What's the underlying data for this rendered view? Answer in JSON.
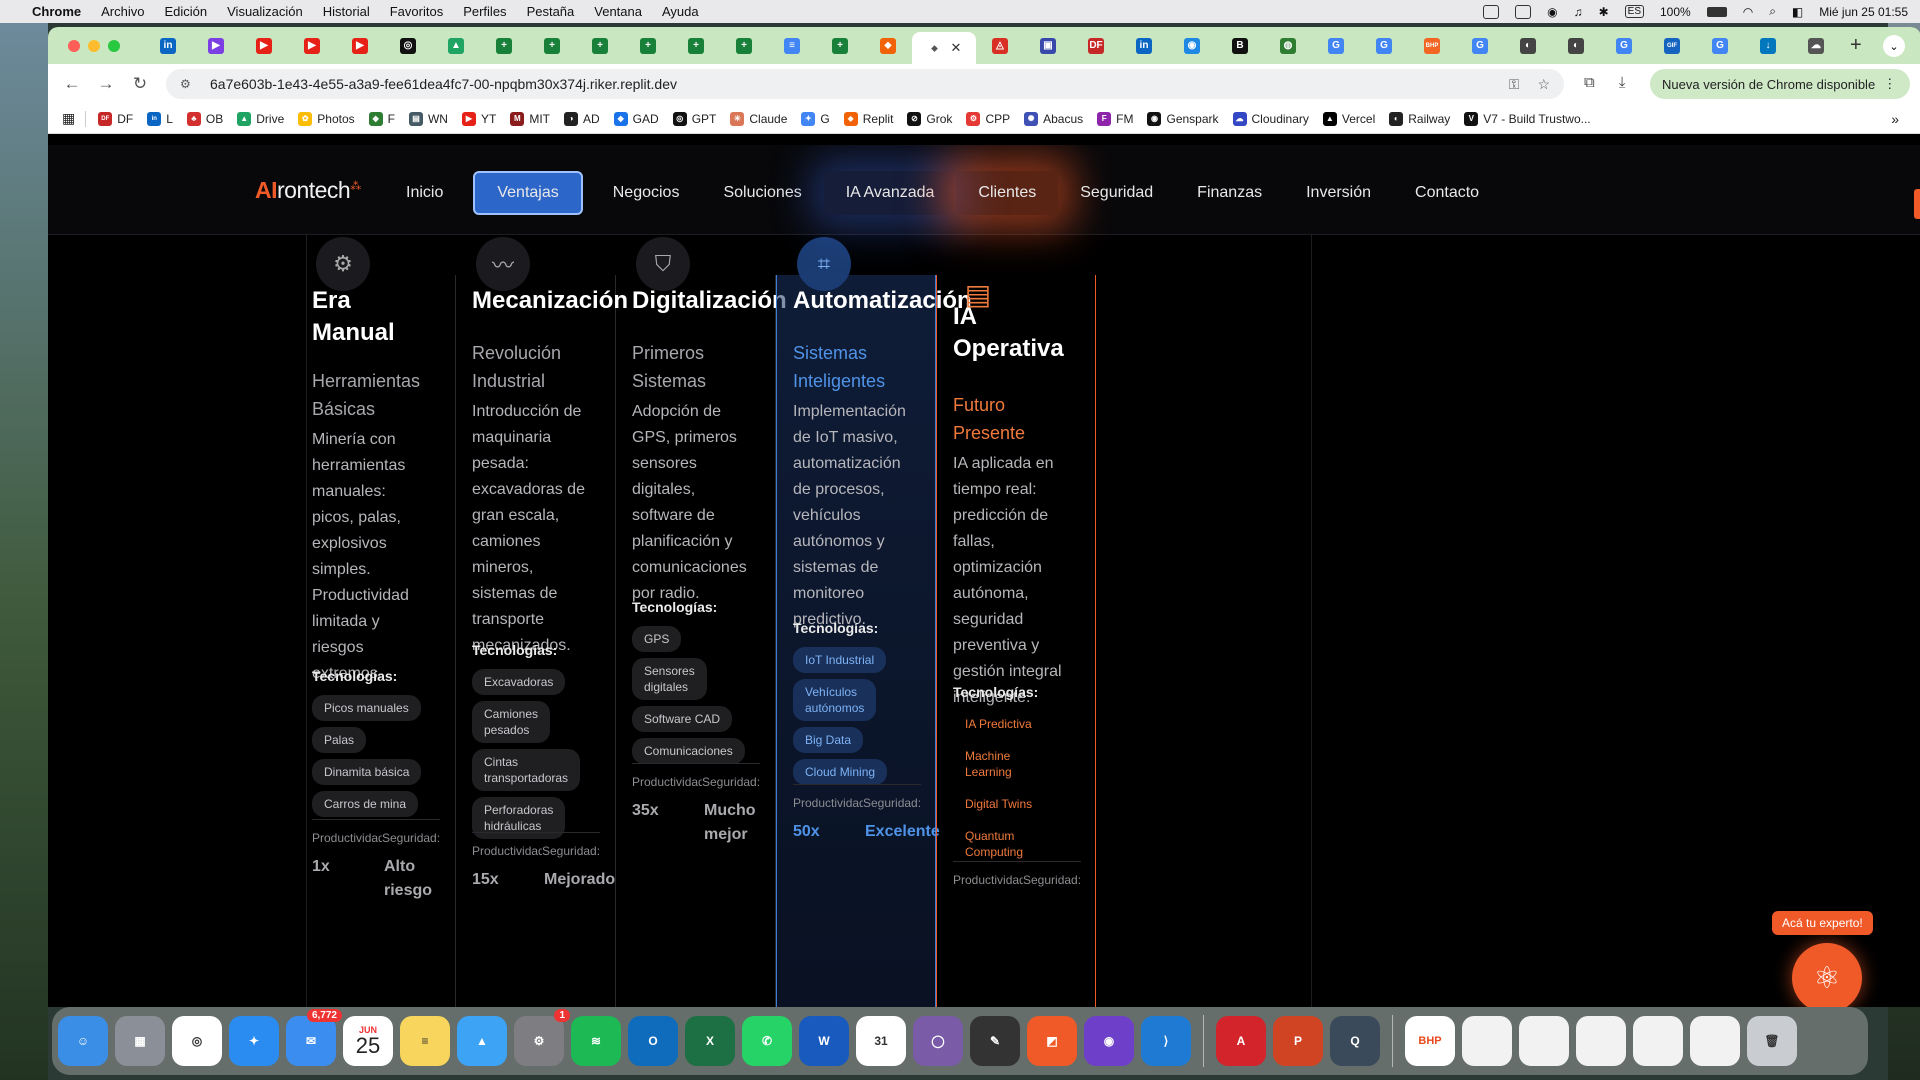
{
  "menubar": {
    "app": "Chrome",
    "items": [
      "Archivo",
      "Edición",
      "Visualización",
      "Historial",
      "Favoritos",
      "Perfiles",
      "Pestaña",
      "Ventana",
      "Ayuda"
    ],
    "battery": "100%",
    "input_source": "ES",
    "datetime": "Mié jun 25  01:55"
  },
  "browser": {
    "url": "6a7e603b-1e43-4e55-a3a9-fee61dea4fc7-00-npqbm30x374j.riker.replit.dev",
    "update_label": "Nueva versión de Chrome disponible",
    "tab_favicons": [
      {
        "glyph": "in",
        "color": "#0a66c2"
      },
      {
        "glyph": "▶",
        "color": "#7b3fe4"
      },
      {
        "glyph": "▶",
        "color": "#e62117"
      },
      {
        "glyph": "▶",
        "color": "#e62117"
      },
      {
        "glyph": "▶",
        "color": "#e62117"
      },
      {
        "glyph": "◎",
        "color": "#111111"
      },
      {
        "glyph": "▲",
        "color": "#1fa463"
      },
      {
        "glyph": "+",
        "color": "#188038"
      },
      {
        "glyph": "+",
        "color": "#188038"
      },
      {
        "glyph": "+",
        "color": "#188038"
      },
      {
        "glyph": "+",
        "color": "#188038"
      },
      {
        "glyph": "+",
        "color": "#188038"
      },
      {
        "glyph": "+",
        "color": "#188038"
      },
      {
        "glyph": "≡",
        "color": "#4285f4"
      },
      {
        "glyph": "+",
        "color": "#188038"
      },
      {
        "glyph": "⬥",
        "color": "#f26207"
      }
    ],
    "tab_favicons_right": [
      {
        "glyph": "◬",
        "color": "#d93025"
      },
      {
        "glyph": "▣",
        "color": "#3949ab"
      },
      {
        "glyph": "DF",
        "color": "#c62828"
      },
      {
        "glyph": "in",
        "color": "#0a66c2"
      },
      {
        "glyph": "◉",
        "color": "#1e88e5"
      },
      {
        "glyph": "B",
        "color": "#111111"
      },
      {
        "glyph": "◍",
        "color": "#2e7d32"
      },
      {
        "glyph": "G",
        "color": "#4285f4"
      },
      {
        "glyph": "G",
        "color": "#4285f4"
      },
      {
        "glyph": "BHP",
        "color": "#f26522"
      },
      {
        "glyph": "G",
        "color": "#4285f4"
      },
      {
        "glyph": "◐",
        "color": "#444444"
      },
      {
        "glyph": "◐",
        "color": "#444444"
      },
      {
        "glyph": "G",
        "color": "#4285f4"
      },
      {
        "glyph": "GIF",
        "color": "#1565c0"
      },
      {
        "glyph": "G",
        "color": "#4285f4"
      },
      {
        "glyph": "↓",
        "color": "#0277bd"
      },
      {
        "glyph": "☁",
        "color": "#555555"
      }
    ],
    "bookmarks": [
      {
        "label": "DF",
        "glyph": "DF",
        "color": "#c62828"
      },
      {
        "label": "L",
        "glyph": "in",
        "color": "#0a66c2"
      },
      {
        "label": "OB",
        "glyph": "♣",
        "color": "#d32f2f"
      },
      {
        "label": "Drive",
        "glyph": "▲",
        "color": "#1fa463"
      },
      {
        "label": "Photos",
        "glyph": "✿",
        "color": "#fbbc04"
      },
      {
        "label": "F",
        "glyph": "◆",
        "color": "#2e7d32"
      },
      {
        "label": "WN",
        "glyph": "▤",
        "color": "#455a64"
      },
      {
        "label": "YT",
        "glyph": "▶",
        "color": "#e62117"
      },
      {
        "label": "MIT",
        "glyph": "M",
        "color": "#8a1c1c"
      },
      {
        "label": "AD",
        "glyph": "◑",
        "color": "#222222"
      },
      {
        "label": "GAD",
        "glyph": "◆",
        "color": "#1a73e8"
      },
      {
        "label": "GPT",
        "glyph": "◎",
        "color": "#111111"
      },
      {
        "label": "Claude",
        "glyph": "✳",
        "color": "#d97757"
      },
      {
        "label": "G",
        "glyph": "✦",
        "color": "#4285f4"
      },
      {
        "label": "Replit",
        "glyph": "⬥",
        "color": "#f26207"
      },
      {
        "label": "Grok",
        "glyph": "⊘",
        "color": "#111111"
      },
      {
        "label": "CPP",
        "glyph": "⚙",
        "color": "#e53935"
      },
      {
        "label": "Abacus",
        "glyph": "✺",
        "color": "#3f51b5"
      },
      {
        "label": "FM",
        "glyph": "F",
        "color": "#8e24aa"
      },
      {
        "label": "Genspark",
        "glyph": "◉",
        "color": "#111111"
      },
      {
        "label": "Cloudinary",
        "glyph": "☁",
        "color": "#3448c5"
      },
      {
        "label": "Vercel",
        "glyph": "▲",
        "color": "#000000"
      },
      {
        "label": "Railway",
        "glyph": "◐",
        "color": "#222222"
      },
      {
        "label": "V7 - Build Trustwo...",
        "glyph": "V",
        "color": "#111111"
      }
    ]
  },
  "site": {
    "logo_ai": "AI",
    "logo_rest": "rontech",
    "nav": [
      "Inicio",
      "Ventajas",
      "Negocios",
      "Soluciones",
      "IA Avanzada",
      "Clientes",
      "Seguridad",
      "Finanzas",
      "Inversión",
      "Contacto"
    ],
    "tech_label": "Tecnologías:",
    "stat_label_productivity": "Productividad",
    "stat_label_security": "Seguridad:",
    "expert_label": "Acá tu experto!",
    "accent_orange": "#f05a28",
    "accent_blue": "#4f93e8"
  },
  "eras": [
    {
      "title": "Era\nManual",
      "subtitle": "Herramientas\nBásicas",
      "description": "Minería con\nherramientas\nmanuales:\npicos, palas,\nexplosivos\nsimples.\nProductividad\nlimitada y\nriesgos\nextremos.",
      "technologies": [
        "Picos manuales",
        "Palas",
        "Dinamita básica",
        "Carros de mina"
      ],
      "productivity": "1x",
      "security": "Alto\nriesgo",
      "icon": "gear-icon"
    },
    {
      "title": "Mecanización",
      "subtitle": "Revolución\nIndustrial",
      "description": "Introducción de\nmaquinaria\npesada:\nexcavadoras de\ngran escala,\ncamiones\nmineros,\nsistemas de\ntransporte\nmecanizados.",
      "technologies": [
        "Excavadoras",
        "Camiones\npesados",
        "Cintas\ntransportadoras",
        "Perforadoras\nhidráulicas"
      ],
      "productivity": "15x",
      "security": "Mejorado",
      "icon": "trend-icon"
    },
    {
      "title": "Digitalización",
      "subtitle": "Primeros\nSistemas",
      "description": "Adopción de\nGPS, primeros\nsensores\ndigitales,\nsoftware de\nplanificación y\ncomunicaciones\npor radio.",
      "technologies": [
        "GPS",
        "Sensores\ndigitales",
        "Software CAD",
        "Comunicaciones"
      ],
      "productivity": "35x",
      "security": "Mucho\nmejor",
      "icon": "shield-icon"
    },
    {
      "title": "Automatización",
      "subtitle": "Sistemas\nInteligentes",
      "description": "Implementación\nde IoT masivo,\nautomatización\nde procesos,\nvehículos\nautónomos y\nsistemas de\nmonitoreo\npredictivo.",
      "technologies": [
        "IoT Industrial",
        "Vehículos\nautónomos",
        "Big Data",
        "Cloud Mining"
      ],
      "productivity": "50x",
      "security": "Excelente",
      "icon": "chip-icon"
    },
    {
      "title": "IA\nOperativa",
      "subtitle": "Futuro\nPresente",
      "description": "IA aplicada en\ntiempo real:\npredicción de\nfallas,\noptimización\nautónoma,\nseguridad\npreventiva y\ngestión integral\ninteligente.",
      "technologies": [
        "IA Predictiva",
        "Machine\nLearning",
        "Digital Twins",
        "Quantum\nComputing"
      ],
      "icon": "document-icon"
    }
  ],
  "dock": {
    "mail_badge": "6,772",
    "calendar_month": "JUN",
    "calendar_day": "25",
    "settings_badge": "1",
    "apps": [
      {
        "name": "finder",
        "color": "#3a8ee6",
        "glyph": "☺"
      },
      {
        "name": "launchpad",
        "color": "#8a8f98",
        "glyph": "▦"
      },
      {
        "name": "chrome",
        "color": "#ffffff",
        "glyph": "◎"
      },
      {
        "name": "safari",
        "color": "#2a8cf0",
        "glyph": "✦"
      },
      {
        "name": "mail",
        "color": "#3b8def",
        "glyph": "✉"
      },
      {
        "name": "calendar",
        "color": "#ffffff",
        "glyph": ""
      },
      {
        "name": "notes",
        "color": "#f8d55c",
        "glyph": "≡"
      },
      {
        "name": "preview",
        "color": "#3da3f5",
        "glyph": "▲"
      },
      {
        "name": "system-settings",
        "color": "#7d7d82",
        "glyph": "⚙"
      },
      {
        "name": "spotify",
        "color": "#1db954",
        "glyph": "≋"
      },
      {
        "name": "outlook",
        "color": "#0f6cbd",
        "glyph": "O"
      },
      {
        "name": "excel",
        "color": "#1d7044",
        "glyph": "X"
      },
      {
        "name": "whatsapp",
        "color": "#25d366",
        "glyph": "✆"
      },
      {
        "name": "word",
        "color": "#185abd",
        "glyph": "W"
      },
      {
        "name": "calendar-31",
        "color": "#ffffff",
        "glyph": "31"
      },
      {
        "name": "mirror",
        "color": "#7a5ba8",
        "glyph": "◯"
      },
      {
        "name": "pencil",
        "color": "#333333",
        "glyph": "✎"
      },
      {
        "name": "swiftkey",
        "color": "#f05a28",
        "glyph": "◩"
      },
      {
        "name": "github",
        "color": "#6e40c9",
        "glyph": "◉"
      },
      {
        "name": "vscode",
        "color": "#1f7ad4",
        "glyph": "⟩"
      },
      {
        "name": "acrobat",
        "color": "#d2242a",
        "glyph": "A"
      },
      {
        "name": "powerpoint",
        "color": "#d04423",
        "glyph": "P"
      },
      {
        "name": "quicktime",
        "color": "#3a4a5a",
        "glyph": "Q"
      },
      {
        "name": "bhp-doc",
        "color": "#ffffff",
        "glyph": "BHP"
      },
      {
        "name": "doc-1",
        "color": "#f2f2f2",
        "glyph": ""
      },
      {
        "name": "doc-2",
        "color": "#f2f2f2",
        "glyph": ""
      },
      {
        "name": "doc-3",
        "color": "#f2f2f2",
        "glyph": ""
      },
      {
        "name": "doc-4",
        "color": "#f2f2f2",
        "glyph": ""
      },
      {
        "name": "doc-5",
        "color": "#f2f2f2",
        "glyph": ""
      },
      {
        "name": "trash",
        "color": "#c9cdd2",
        "glyph": "🗑"
      }
    ]
  }
}
